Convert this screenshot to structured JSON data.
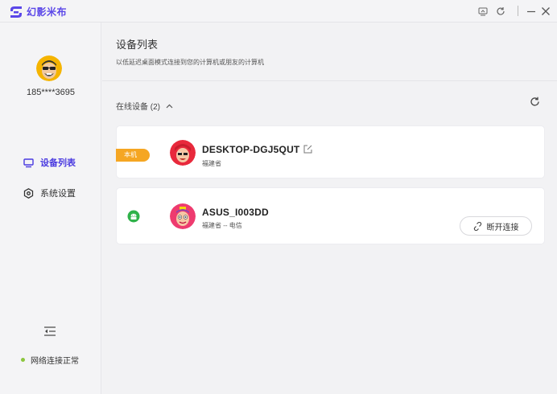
{
  "app": {
    "name": "幻影米布",
    "brand_color": "#5a46e8"
  },
  "titlebar": {
    "icons": [
      "screen-icon",
      "refresh-icon",
      "minimize-icon",
      "close-icon"
    ]
  },
  "user": {
    "phone": "185****3695"
  },
  "sidebar": {
    "items": [
      {
        "label": "设备列表",
        "icon": "monitor-icon",
        "active": true
      },
      {
        "label": "系统设置",
        "icon": "settings-icon",
        "active": false
      }
    ],
    "network_status": "网络连接正常",
    "status_color": "#8cc63e"
  },
  "page": {
    "title": "设备列表",
    "subtitle": "以低延迟桌面模式连接到您的计算机或朋友的计算机"
  },
  "online": {
    "label": "在线设备 (2)"
  },
  "devices": [
    {
      "tag": "本机",
      "name": "DESKTOP-DGJ5QUT",
      "location": "福建省"
    },
    {
      "name": "ASUS_I003DD",
      "location": "福建省 -- 电信",
      "action": "断开连接"
    }
  ],
  "colors": {
    "accent": "#4a3ae0",
    "tag": "#f5a623",
    "android": "#2fb24a"
  }
}
